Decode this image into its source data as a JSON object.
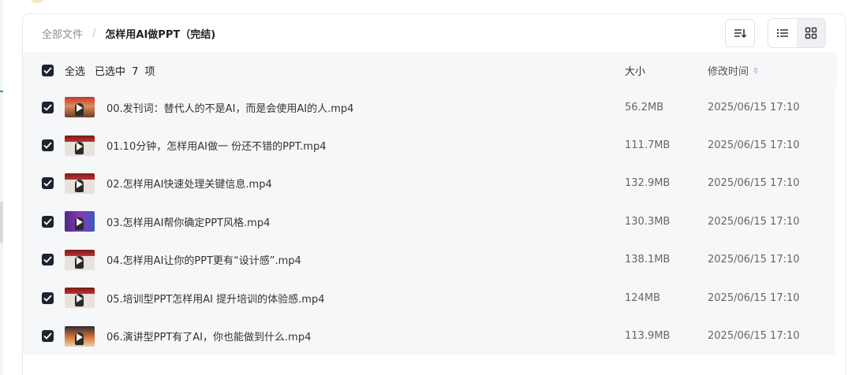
{
  "breadcrumb": {
    "root": "全部文件",
    "current": "怎样用AI做PPT（完结)"
  },
  "toolbar": {
    "sort_icon": "sort-icon",
    "list_view_icon": "list-view-icon",
    "grid_view_icon": "grid-view-icon",
    "active_view": "grid"
  },
  "table": {
    "select_all_label": "全选",
    "selected_info": "已选中 7 项",
    "col_size": "大小",
    "col_time": "修改时间"
  },
  "files": [
    {
      "name": "00.发刊词：替代人的不是AI，而是会使用AI的人.mp4",
      "size": "56.2MB",
      "modified": "2025/06/15 17:10",
      "checked": true
    },
    {
      "name": "01.10分钟，怎样用AI做一 份还不错的PPT.mp4",
      "size": "111.7MB",
      "modified": "2025/06/15 17:10",
      "checked": true
    },
    {
      "name": "02.怎样用AI快速处理关键信息.mp4",
      "size": "132.9MB",
      "modified": "2025/06/15 17:10",
      "checked": true
    },
    {
      "name": "03.怎样用AI帮你确定PPT风格.mp4",
      "size": "130.3MB",
      "modified": "2025/06/15 17:10",
      "checked": true
    },
    {
      "name": "04.怎样用AI让你的PPT更有“设计感”.mp4",
      "size": "138.1MB",
      "modified": "2025/06/15 17:10",
      "checked": true
    },
    {
      "name": "05.培训型PPT怎样用AI 提升培训的体验感.mp4",
      "size": "124MB",
      "modified": "2025/06/15 17:10",
      "checked": true
    },
    {
      "name": "06.演讲型PPT有了AI，你也能做到什么.mp4",
      "size": "113.9MB",
      "modified": "2025/06/15 17:10",
      "checked": true
    }
  ],
  "colors": {
    "accent_dark": "#1e2330",
    "row_bg": "#f6f7f9"
  }
}
